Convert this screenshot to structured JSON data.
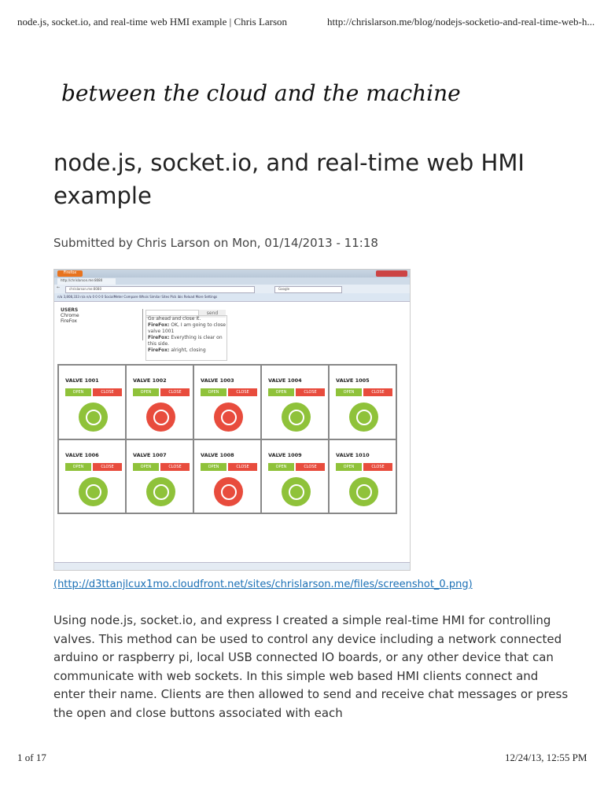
{
  "print_header": {
    "left": "node.js, socket.io, and real-time web HMI example | Chris Larson",
    "right": "http://chrislarson.me/blog/nodejs-socketio-and-real-time-web-h..."
  },
  "site_name": "between the cloud and the machine",
  "article": {
    "title": "node.js, socket.io, and real-time web HMI example",
    "submitted": "Submitted by Chris Larson on Mon, 01/14/2013 - 11:18",
    "image_link": "(http://d3ttanjlcux1mo.cloudfront.net/sites/chrislarson.me/files/screenshot_0.png)",
    "body": "Using node.js, socket.io, and express I created a simple real-time HMI for controlling valves. This method can be used to control any device including a network connected arduino or raspberry pi, local USB connected IO boards, or any other device that can communicate with web sockets. In this simple web based HMI clients connect and enter their name. Clients are then allowed to send and receive chat messages or press the open and close buttons associated with each"
  },
  "screenshot": {
    "browser_button": "Firefox",
    "tab": "http://chrislarson.me:8080",
    "url": "chrislarson.me:8080",
    "search": "Google",
    "bookmarks": "n/a  3,808,333  n/a  n/a  0  0  0  0  SocialMeter  Compare  Whois  Similar Sites  Pick ibis  Reload  More  Settings",
    "users_title": "USERS",
    "users": [
      "Chrome",
      "FireFox"
    ],
    "send": "send",
    "chat": [
      {
        "who": "",
        "msg": "Go ahead and close it."
      },
      {
        "who": "FireFox:",
        "msg": " OK, I am going to close valve 1001"
      },
      {
        "who": "FireFox:",
        "msg": " Everything is clear on this side."
      },
      {
        "who": "FireFox:",
        "msg": " alright, closing"
      }
    ],
    "open": "OPEN",
    "close": "CLOSE",
    "colors": {
      "open": "#8fc23a",
      "closed": "#e84c3d"
    },
    "valves": [
      {
        "name": "VALVE 1001",
        "state": "open"
      },
      {
        "name": "VALVE 1002",
        "state": "closed"
      },
      {
        "name": "VALVE 1003",
        "state": "closed"
      },
      {
        "name": "VALVE 1004",
        "state": "open"
      },
      {
        "name": "VALVE 1005",
        "state": "open"
      },
      {
        "name": "VALVE 1006",
        "state": "open"
      },
      {
        "name": "VALVE 1007",
        "state": "open"
      },
      {
        "name": "VALVE 1008",
        "state": "closed"
      },
      {
        "name": "VALVE 1009",
        "state": "open"
      },
      {
        "name": "VALVE 1010",
        "state": "open"
      }
    ]
  },
  "footer": {
    "page": "1 of 17",
    "datetime": "12/24/13, 12:55 PM"
  }
}
